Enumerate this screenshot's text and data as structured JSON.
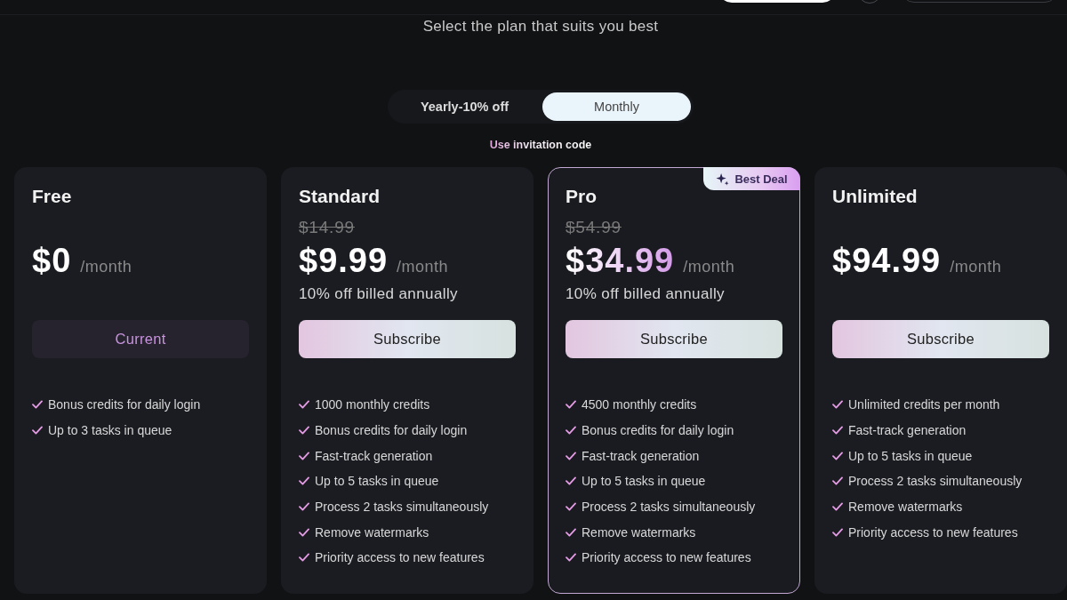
{
  "subtitle": "Select the plan that suits you best",
  "billing_toggle": [
    {
      "label": "Yearly-10% off",
      "selected": false
    },
    {
      "label": "Monthly",
      "selected": true
    }
  ],
  "invitation_link": "Use invitation code",
  "plans": [
    {
      "name": "Free",
      "highlighted": false,
      "price": "$0",
      "period": "/month",
      "button": {
        "label": "Current",
        "kind": "current"
      },
      "features": [
        "Bonus credits for daily login",
        "Up to 3 tasks in queue"
      ]
    },
    {
      "name": "Standard",
      "highlighted": false,
      "original_price": "$14.99",
      "price": "$9.99",
      "period": "/month",
      "note": "10% off billed annually",
      "button": {
        "label": "Subscribe",
        "kind": "subscribe"
      },
      "features": [
        "1000 monthly credits",
        "Bonus credits for daily login",
        "Fast-track generation",
        "Up to 5 tasks in queue",
        "Process 2 tasks simultaneously",
        "Remove watermarks",
        "Priority access to new features"
      ]
    },
    {
      "name": "Pro",
      "highlighted": true,
      "badge": "Best Deal",
      "original_price": "$54.99",
      "price": "$34.99",
      "period": "/month",
      "note": "10% off billed annually",
      "button": {
        "label": "Subscribe",
        "kind": "subscribe"
      },
      "features": [
        "4500 monthly credits",
        "Bonus credits for daily login",
        "Fast-track generation",
        "Up to 5 tasks in queue",
        "Process 2 tasks simultaneously",
        "Remove watermarks",
        "Priority access to new features"
      ]
    },
    {
      "name": "Unlimited",
      "highlighted": false,
      "price": "$94.99",
      "period": "/month",
      "button": {
        "label": "Subscribe",
        "kind": "subscribe"
      },
      "features": [
        "Unlimited credits per month",
        "Fast-track generation",
        "Up to 5 tasks in queue",
        "Process 2 tasks simultaneously",
        "Remove watermarks",
        "Priority access to new features"
      ]
    }
  ]
}
